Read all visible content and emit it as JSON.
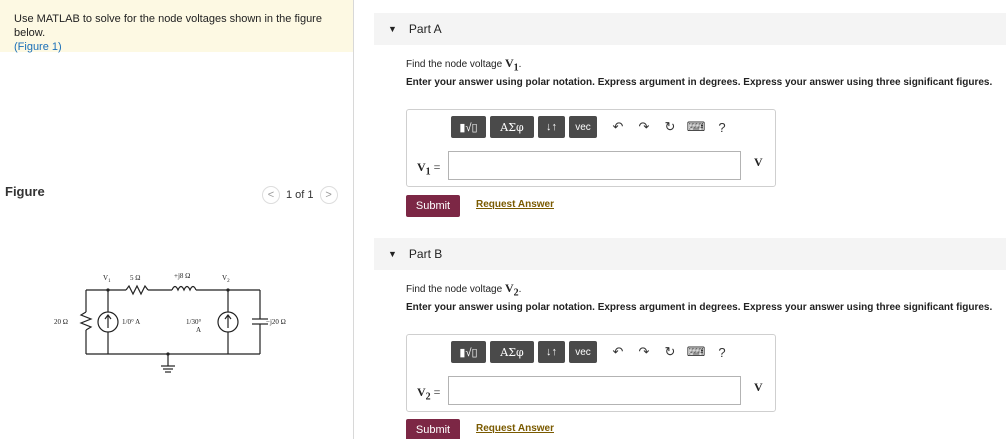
{
  "intro": {
    "text": "Use MATLAB to solve for the node voltages shown in the figure below.",
    "figure_link": "(Figure 1)"
  },
  "figure": {
    "title": "Figure",
    "pager": "1 of 1",
    "prev": "<",
    "next": ">"
  },
  "circuit": {
    "v1": "V",
    "v1_sub": "1",
    "v2": "V",
    "v2_sub": "2",
    "r5": "5 Ω",
    "l8": "+j8 Ω",
    "r20": "20 Ω",
    "src1": "1/0° A",
    "src2": "1/30°",
    "src2_unit": "A",
    "cap": "−j20 Ω"
  },
  "toolbar": {
    "templates": "▮√▯",
    "greek": "ΑΣφ",
    "arrows": "↓↑",
    "vec": "vec",
    "undo": "↶",
    "redo": "↷",
    "reset": "↻",
    "keyboard": "⌨",
    "help": "?"
  },
  "parts": [
    {
      "title": "Part A",
      "question": "Find the node voltage",
      "var": "V",
      "var_sub": "1",
      "instructions": "Enter your answer using polar notation. Express argument in degrees. Express your answer using three significant figures.",
      "input_label": "V",
      "input_sub": "1",
      "input_eq": " =",
      "input_value": "",
      "unit": "V",
      "submit": "Submit",
      "request": "Request Answer"
    },
    {
      "title": "Part B",
      "question": "Find the node voltage",
      "var": "V",
      "var_sub": "2",
      "instructions": "Enter your answer using polar notation. Express argument in degrees. Express your answer using three significant figures.",
      "input_label": "V",
      "input_sub": "2",
      "input_eq": " =",
      "input_value": "",
      "unit": "V",
      "submit": "Submit",
      "request": "Request Answer"
    }
  ]
}
